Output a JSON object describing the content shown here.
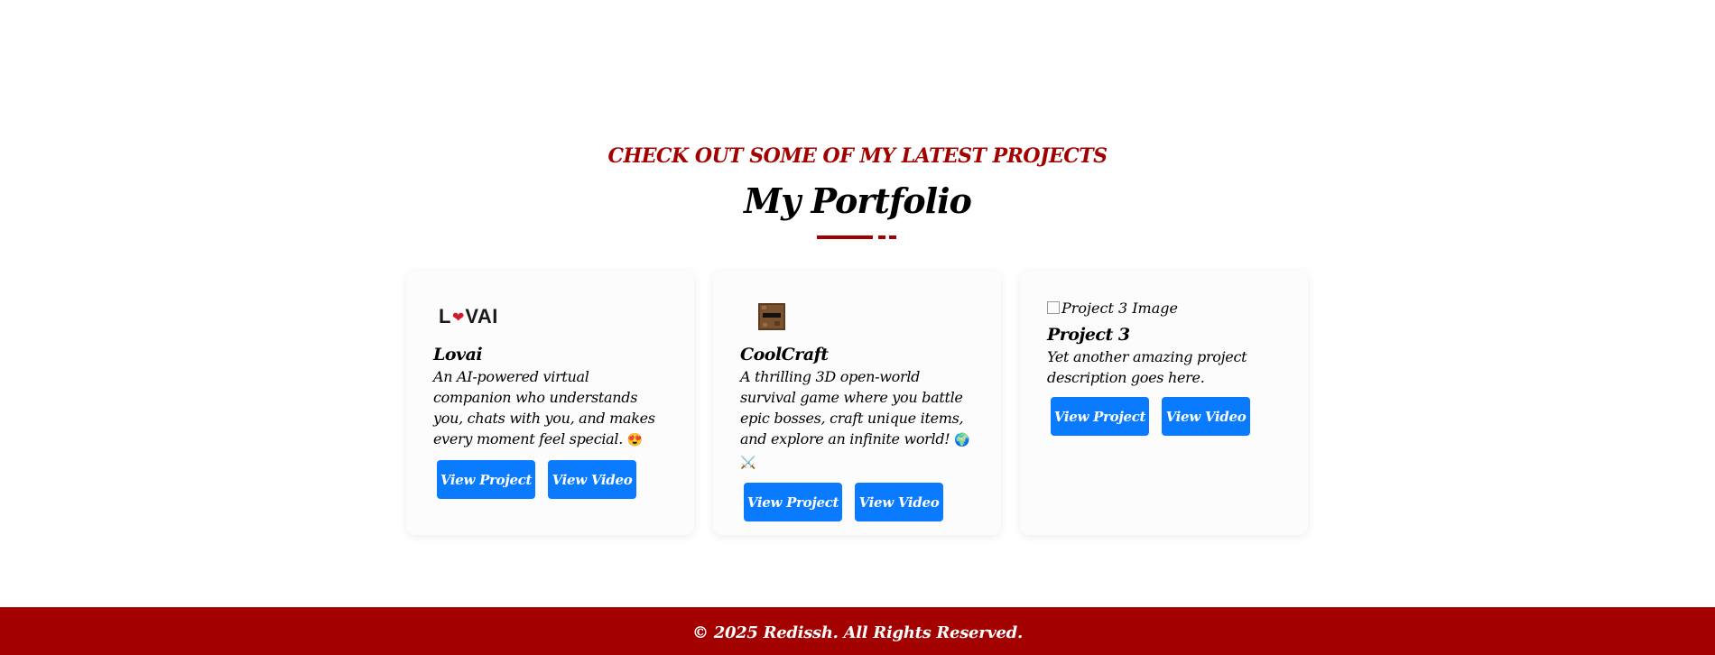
{
  "portfolio": {
    "subtitle": "CHECK OUT SOME OF MY LATEST PROJECTS",
    "title": "My Portfolio"
  },
  "projects": [
    {
      "logo_text_l": "L",
      "logo_text_rest": "VAI",
      "name": "Lovai",
      "description": "An AI-powered virtual companion who understands you, chats with you, and makes every moment feel special.",
      "emoji": "😍",
      "project_label": "View Project",
      "video_label": "View Video"
    },
    {
      "name": "CoolCraft",
      "description": "A thrilling 3D open-world survival game where you battle epic bosses, craft unique items, and explore an infinite world!",
      "emoji": "🌍 ⚔️",
      "project_label": "View Project",
      "video_label": "View Video"
    },
    {
      "image_alt": "Project 3 Image",
      "name": "Project 3",
      "description": "Yet another amazing project description goes here.",
      "project_label": "View Project",
      "video_label": "View Video"
    }
  ],
  "footer": {
    "text": "© 2025 Redissh. All Rights Reserved."
  },
  "colors": {
    "accent": "#a30000",
    "button": "#0a7bff"
  }
}
